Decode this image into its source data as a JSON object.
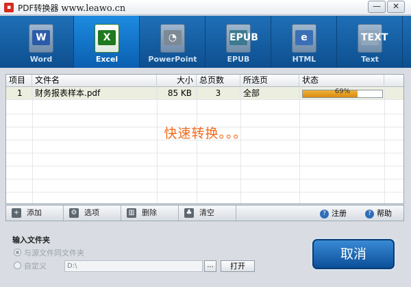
{
  "window": {
    "title_prefix": "PDF转换器",
    "title_url": "www.leawo.cn",
    "minimize_icon": "—",
    "close_icon": "✕"
  },
  "tabs": [
    {
      "label": "Word",
      "badge": "W"
    },
    {
      "label": "Excel",
      "badge": "X"
    },
    {
      "label": "PowerPoint",
      "badge": "◔"
    },
    {
      "label": "EPUB",
      "badge": "EPUB"
    },
    {
      "label": "HTML",
      "badge": "e"
    },
    {
      "label": "Text",
      "badge": "TEXT"
    }
  ],
  "active_tab": "Excel",
  "table": {
    "headers": [
      "项目",
      "文件名",
      "大小",
      "总页数",
      "所选页",
      "状态"
    ],
    "rows": [
      {
        "index": "1",
        "filename": "财务报表样本.pdf",
        "size": "85  KB",
        "pages": "3",
        "selected_pages": "全部",
        "progress": 0.69,
        "progress_text": "69%"
      }
    ]
  },
  "status_message": "快速转换。。。",
  "actions": {
    "add": "添加",
    "options": "选项",
    "delete": "删除",
    "clear": "清空",
    "register": "注册",
    "help": "帮助"
  },
  "input_folder": {
    "title": "输入文件夹",
    "option_same": "与源文件同文件夹",
    "option_custom": "自定义",
    "path_value": "D:\\",
    "browse_label": "...",
    "open_label": "打开"
  },
  "cancel_label": "取消",
  "colors": {
    "tab_bar": "#1f6fb7",
    "progress": "#e6a023",
    "status_message": "#ee6a1a"
  }
}
